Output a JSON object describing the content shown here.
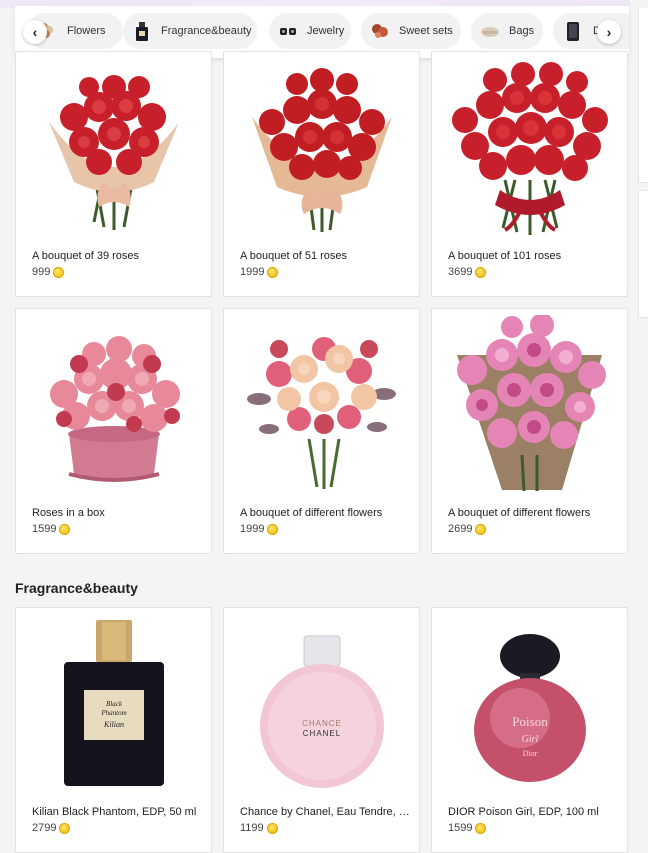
{
  "categories": [
    {
      "label": "Flowers",
      "icon": "flower-icon"
    },
    {
      "label": "Fragrance&beauty",
      "icon": "perfume-icon"
    },
    {
      "label": "Jewelry",
      "icon": "jewelry-icon"
    },
    {
      "label": "Sweet sets",
      "icon": "candy-icon"
    },
    {
      "label": "Bags",
      "icon": "bag-icon"
    },
    {
      "label": "D",
      "icon": "device-icon"
    }
  ],
  "nav": {
    "prev": "‹",
    "next": "›"
  },
  "sections": {
    "fragrance_title": "Fragrance&beauty"
  },
  "flowers": [
    {
      "name": "A bouquet of 39 roses",
      "price": "999"
    },
    {
      "name": "A bouquet of 51 roses",
      "price": "1999"
    },
    {
      "name": "A bouquet of 101 roses",
      "price": "3699"
    },
    {
      "name": "Roses in a box",
      "price": "1599"
    },
    {
      "name": "A bouquet of different flowers",
      "price": "1999"
    },
    {
      "name": "A bouquet of different flowers",
      "price": "2699"
    }
  ],
  "fragrance": [
    {
      "name": "Kilian Black Phantom, EDP, 50 ml",
      "price": "2799",
      "label_text": "Black Phantom Kilian"
    },
    {
      "name": "Chance by Chanel, Eau Tendre, EDT",
      "price": "1199",
      "label_text": "CHANCE CHANEL"
    },
    {
      "name": "DIOR Poison Girl, EDP, 100 ml",
      "price": "1599",
      "label_text": "Poison Girl Dior"
    }
  ],
  "colors": {
    "accent": "#f0b800",
    "rose_red": "#c8202a",
    "rose_pink": "#e8899a",
    "card_bg": "#ffffff"
  }
}
